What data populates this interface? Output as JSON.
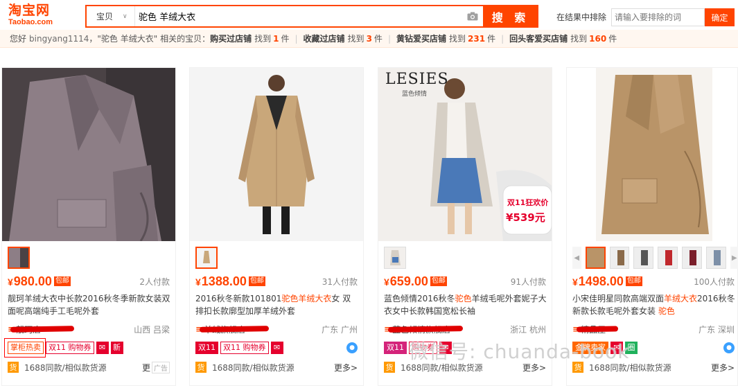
{
  "header": {
    "logo_cn": "淘宝网",
    "logo_en": "Taobao.com",
    "scope": "宝贝",
    "query": "驼色 羊绒大衣",
    "search_label": "搜 索",
    "exclude_label": "在结果中排除",
    "exclude_placeholder": "请输入要排除的词",
    "exclude_button": "确定"
  },
  "info_bar": {
    "greeting": "您好",
    "user": "bingyang1114",
    "query_text": "，\"驼色 羊绒大衣\" 相关的宝贝：",
    "groups": [
      {
        "label": "购买过店铺",
        "pre": "找到",
        "count": "1",
        "unit": "件"
      },
      {
        "label": "收藏过店铺",
        "pre": "找到",
        "count": "3",
        "unit": "件"
      },
      {
        "label": "黄钻爱买店铺",
        "pre": "找到",
        "count": "231",
        "unit": "件"
      },
      {
        "label": "回头客爱买店铺",
        "pre": "找到",
        "count": "160",
        "unit": "件"
      }
    ]
  },
  "products": [
    {
      "price": "980.00",
      "free_ship": "包邮",
      "paid": "2人付款",
      "title_a": "靓珂羊绒大衣中长款2016秋冬季新款女装双面呢高端纯手工毛呢外套",
      "title_hl": "",
      "title_b": "",
      "shop_icon": "≡",
      "shop": "靓珂店",
      "location": "山西 吕梁",
      "badges": [
        "掌柜热卖",
        "双11 购物券",
        "✉",
        "新"
      ],
      "huo": "货",
      "sources": "1688同款/相似款货源",
      "more": "更",
      "ad": "广告"
    },
    {
      "price": "1388.00",
      "free_ship": "包邮",
      "paid": "31人付款",
      "title_a": "2016秋冬新款101801",
      "title_hl": "驼色羊绒大衣",
      "title_b": "女 双排扣长款廓型加厚羊绒外套",
      "shop_icon": "≡",
      "shop": "羊绒旗舰店",
      "location": "广东 广州",
      "badges": [
        "双11",
        "双11 购物券",
        "✉"
      ],
      "huo": "货",
      "sources": "1688同款/相似款货源",
      "more": "更多>"
    },
    {
      "price": "659.00",
      "free_ship": "包邮",
      "paid": "91人付款",
      "title_a": "蓝色倾情2016秋冬",
      "title_hl": "驼色",
      "title_b": "羊绒毛呢外套妮子大衣女中长款韩国宽松长袖",
      "shop_icon": "≡",
      "shop": "蓝色倾情旗舰店",
      "location": "浙江 杭州",
      "badges": [
        "双11",
        "购物券",
        "✉"
      ],
      "huo": "货",
      "sources": "1688同款/相似款货源",
      "more": "更多>"
    },
    {
      "price": "1498.00",
      "free_ship": "包邮",
      "paid": "100人付款",
      "title_a": "小宋佳明星同款高端双面",
      "title_hl": "羊绒大衣",
      "title_b": "2016秋冬新款长款毛呢外套女装 ",
      "title_hl2": "驼色",
      "shop_icon": "≡",
      "shop": "精品屋",
      "location": "广东 深圳",
      "badges": [
        "金牌卖家",
        "✉",
        "圈"
      ],
      "huo": "货",
      "sources": "1688同款/相似款货源",
      "more": "更多>"
    }
  ],
  "image_text": {
    "brand": "LESIES",
    "brand_sub": "蓝色倾情",
    "promo_title": "双11狂欢价",
    "promo_price": "¥539元"
  },
  "watermark": "微信号: chuanda-book",
  "colors": {
    "accent": "#ff4400",
    "camel": "#c9a77a",
    "mauve": "#8a7a82"
  }
}
